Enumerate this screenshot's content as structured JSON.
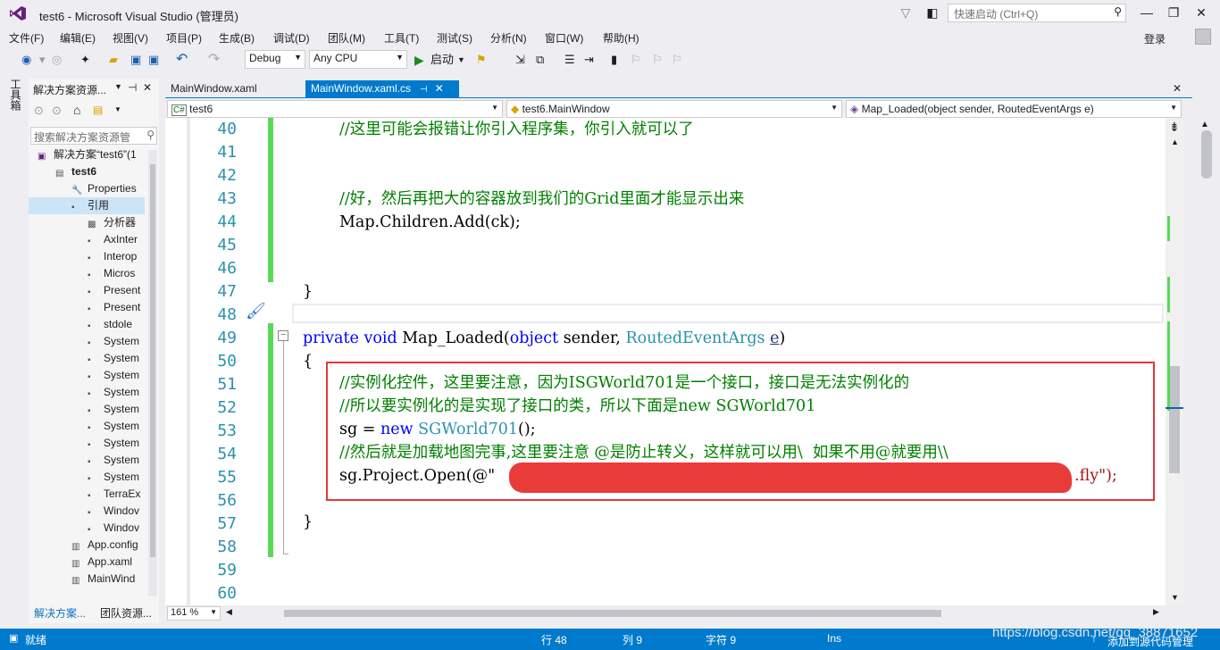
{
  "title": {
    "text": "test6 - Microsoft Visual Studio (管理员)",
    "quick_launch": "快速启动 (Ctrl+Q)"
  },
  "menu": [
    "文件(F)",
    "编辑(E)",
    "视图(V)",
    "项目(P)",
    "生成(B)",
    "调试(D)",
    "团队(M)",
    "工具(T)",
    "测试(S)",
    "分析(N)",
    "窗口(W)",
    "帮助(H)"
  ],
  "login": "登录",
  "toolbar": {
    "config": "Debug",
    "platform": "Any CPU",
    "start": "启动"
  },
  "toolbox_label": "工具箱",
  "solution_explorer": {
    "header": "解决方案资源...",
    "search_placeholder": "搜索解决方案资源管",
    "items": [
      {
        "label": "解决方案“test6”(1",
        "indent": 10
      },
      {
        "label": "test6",
        "indent": 30
      },
      {
        "label": "Properties",
        "indent": 48
      },
      {
        "label": "引用",
        "indent": 48
      },
      {
        "label": "分析器",
        "indent": 66
      },
      {
        "label": "AxInter",
        "indent": 66
      },
      {
        "label": "Interop",
        "indent": 66
      },
      {
        "label": "Micros",
        "indent": 66
      },
      {
        "label": "Present",
        "indent": 66
      },
      {
        "label": "Present",
        "indent": 66
      },
      {
        "label": "stdole",
        "indent": 66
      },
      {
        "label": "System",
        "indent": 66
      },
      {
        "label": "System",
        "indent": 66
      },
      {
        "label": "System",
        "indent": 66
      },
      {
        "label": "System",
        "indent": 66
      },
      {
        "label": "System",
        "indent": 66
      },
      {
        "label": "System",
        "indent": 66
      },
      {
        "label": "System",
        "indent": 66
      },
      {
        "label": "System",
        "indent": 66
      },
      {
        "label": "System",
        "indent": 66
      },
      {
        "label": "TerraEx",
        "indent": 66
      },
      {
        "label": "Windov",
        "indent": 66
      },
      {
        "label": "Windov",
        "indent": 66
      },
      {
        "label": "App.config",
        "indent": 48
      },
      {
        "label": "App.xaml",
        "indent": 48
      },
      {
        "label": "MainWind",
        "indent": 48
      }
    ],
    "tab1": "解决方案...",
    "tab2": "团队资源..."
  },
  "tabs": {
    "tab1": "MainWindow.xaml",
    "tab2": "MainWindow.xaml.cs"
  },
  "nav": {
    "project": "test6",
    "class": "test6.MainWindow",
    "member": "Map_Loaded(object sender, RoutedEventArgs e)"
  },
  "code": {
    "line_numbers": [
      "40",
      "41",
      "42",
      "43",
      "44",
      "45",
      "46",
      "47",
      "48",
      "49",
      "50",
      "51",
      "52",
      "53",
      "54",
      "55",
      "56",
      "57",
      "58",
      "59",
      "60"
    ],
    "l40": "//这里可能会报错让你引入程序集，你引入就可以了",
    "l43": "//好，然后再把大的容器放到我们的Grid里面才能显示出来",
    "l44": "Map.Children.Add(ck);",
    "l47": "}",
    "l49_kw1": "private",
    "l49_kw2": "void",
    "l49_name": "Map_Loaded(",
    "l49_kw3": "object",
    "l49_mid": "sender,",
    "l49_type": "RoutedEventArgs",
    "l49_e": "e",
    "l49_end": ")",
    "l50": "{",
    "l51": "//实例化控件，这里要注意，因为ISGWorld701是一个接口，接口是无法实例化的",
    "l52": "//所以要实例化的是实现了接口的类，所以下面是new SGWorld701",
    "l53_a": "sg = ",
    "l53_kw": "new",
    "l53_type": "SGWorld701",
    "l53_b": "();",
    "l54": "//然后就是加载地图完事,这里要注意 @是防止转义，这样就可以用\\  如果不用@就要用\\\\",
    "l55_a": "sg.Project.Open(@\"",
    "l55_b": ".fly\");",
    "l57": "}"
  },
  "zoom": "161 %",
  "status": {
    "ready": "就绪",
    "line": "行 48",
    "col": "列 9",
    "char": "字符 9",
    "ins": "Ins",
    "source_control": "添加到源代码管理",
    "watermark": "https://blog.csdn.net/qq_38871652"
  }
}
